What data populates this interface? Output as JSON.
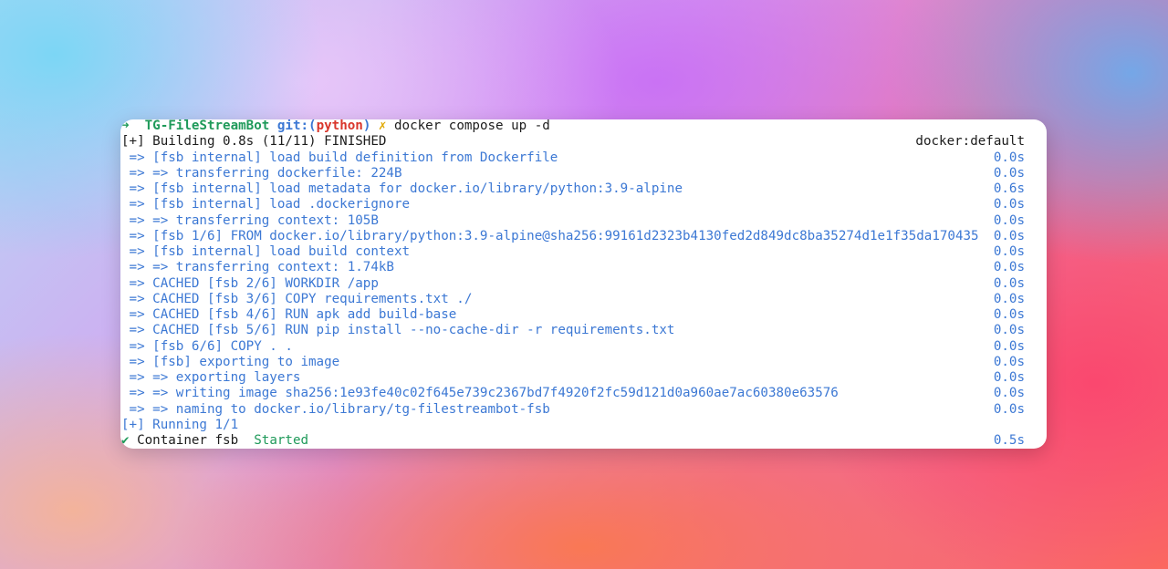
{
  "prompt": {
    "arrow": "➜",
    "dir": "TG-FileStreamBot",
    "git_open": "git:(",
    "branch": "python",
    "git_close": ")",
    "dirty": "✗",
    "command": "docker compose up -d"
  },
  "header": {
    "text": "[+] Building 0.8s (11/11) FINISHED",
    "right": "docker:default"
  },
  "steps": [
    {
      "text": " => [fsb internal] load build definition from Dockerfile",
      "time": "0.0s"
    },
    {
      "text": " => => transferring dockerfile: 224B",
      "time": "0.0s"
    },
    {
      "text": " => [fsb internal] load metadata for docker.io/library/python:3.9-alpine",
      "time": "0.6s"
    },
    {
      "text": " => [fsb internal] load .dockerignore",
      "time": "0.0s"
    },
    {
      "text": " => => transferring context: 105B",
      "time": "0.0s"
    },
    {
      "text": " => [fsb 1/6] FROM docker.io/library/python:3.9-alpine@sha256:99161d2323b4130fed2d849dc8ba35274d1e1f35da170435",
      "time": "0.0s"
    },
    {
      "text": " => [fsb internal] load build context",
      "time": "0.0s"
    },
    {
      "text": " => => transferring context: 1.74kB",
      "time": "0.0s"
    },
    {
      "text": " => CACHED [fsb 2/6] WORKDIR /app",
      "time": "0.0s"
    },
    {
      "text": " => CACHED [fsb 3/6] COPY requirements.txt ./",
      "time": "0.0s"
    },
    {
      "text": " => CACHED [fsb 4/6] RUN apk add build-base",
      "time": "0.0s"
    },
    {
      "text": " => CACHED [fsb 5/6] RUN pip install --no-cache-dir -r requirements.txt",
      "time": "0.0s"
    },
    {
      "text": " => [fsb 6/6] COPY . .",
      "time": "0.0s"
    },
    {
      "text": " => [fsb] exporting to image",
      "time": "0.0s"
    },
    {
      "text": " => => exporting layers",
      "time": "0.0s"
    },
    {
      "text": " => => writing image sha256:1e93fe40c02f645e739c2367bd7f4920f2fc59d121d0a960ae7ac60380e63576",
      "time": "0.0s"
    },
    {
      "text": " => => naming to docker.io/library/tg-filestreambot-fsb",
      "time": "0.0s"
    }
  ],
  "running": "[+] Running 1/1",
  "container": {
    "check": "✔",
    "name": "Container fsb",
    "status": "Started",
    "time": "0.5s"
  },
  "colors": {
    "blue": "#3c78d4",
    "green": "#1f9a5a",
    "red": "#d9362b",
    "yellow": "#e0a800"
  }
}
